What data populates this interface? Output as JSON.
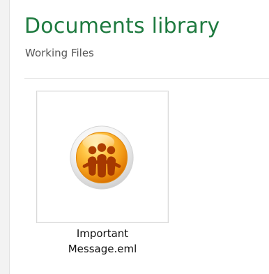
{
  "header": {
    "title": "Documents library",
    "subtitle": "Working Files"
  },
  "files": [
    {
      "name_line1": "Important",
      "name_line2": "Message.eml",
      "icon": "lotus-notes-mail-icon"
    }
  ],
  "colors": {
    "title": "#1e7a3f",
    "subtitle": "#555555",
    "icon_orange": "#f29a16"
  }
}
